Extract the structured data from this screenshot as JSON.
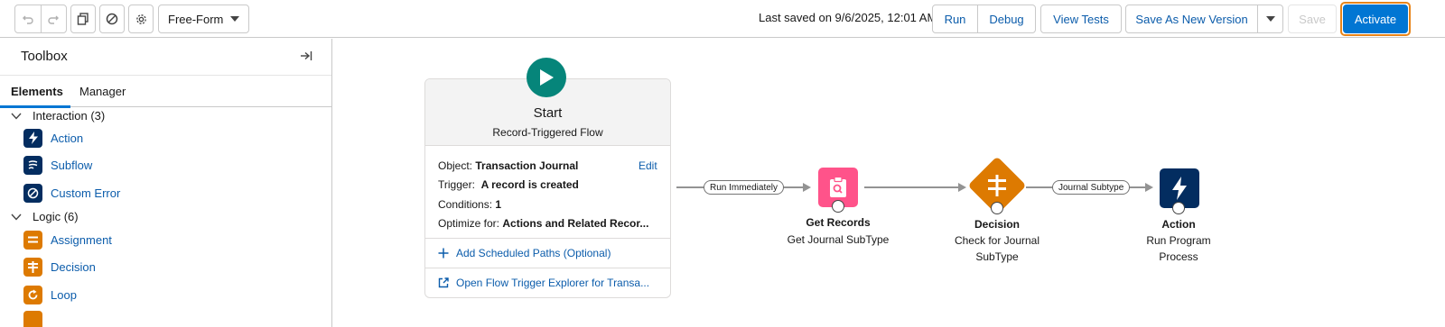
{
  "toolbar": {
    "undo_icon": "undo-icon",
    "redo_icon": "redo-icon",
    "copy_icon": "copy-icon",
    "block_icon": "block-icon",
    "gear_icon": "gear-icon",
    "layout_select": "Free-Form",
    "last_saved": "Last saved on 9/6/2025, 12:01 AM",
    "run_label": "Run",
    "debug_label": "Debug",
    "view_tests_label": "View Tests",
    "save_as_new_version_label": "Save As New Version",
    "save_label": "Save",
    "activate_label": "Activate",
    "colors": {
      "brand": "#0176d3",
      "focus_ring": "#e8851a",
      "disabled_text": "#c9c9c9"
    }
  },
  "sidebar": {
    "title": "Toolbox",
    "tabs": [
      {
        "label": "Elements",
        "active": true
      },
      {
        "label": "Manager",
        "active": false
      }
    ],
    "groups": [
      {
        "label": "Interaction (3)",
        "items": [
          {
            "label": "Action",
            "icon": "lightning-icon",
            "color": "#032d60"
          },
          {
            "label": "Subflow",
            "icon": "subflow-icon",
            "color": "#032d60"
          },
          {
            "label": "Custom Error",
            "icon": "block-icon",
            "color": "#032d60"
          }
        ]
      },
      {
        "label": "Logic (6)",
        "items": [
          {
            "label": "Assignment",
            "icon": "equals-icon",
            "color": "#dd7a01"
          },
          {
            "label": "Decision",
            "icon": "decision-icon",
            "color": "#dd7a01"
          },
          {
            "label": "Loop",
            "icon": "loop-icon",
            "color": "#dd7a01"
          }
        ]
      }
    ]
  },
  "start": {
    "title": "Start",
    "subtitle": "Record-Triggered Flow",
    "object_label": "Object:",
    "object_value": "Transaction Journal",
    "edit_label": "Edit",
    "trigger_label": "Trigger:",
    "trigger_value": "A record is created",
    "conditions_label": "Conditions:",
    "conditions_value": "1",
    "optimize_label": "Optimize for:",
    "optimize_value": "Actions and Related Recor...",
    "add_paths_label": "Add Scheduled Paths (Optional)",
    "explorer_label": "Open Flow Trigger Explorer for Transa..."
  },
  "connectors": {
    "first_label": "Run Immediately",
    "second_label": "Journal Subtype"
  },
  "nodes": [
    {
      "title": "Get Records",
      "subtitle": "Get Journal SubType",
      "icon": "get-records-icon",
      "color": "#ff538a"
    },
    {
      "title": "Decision",
      "subtitle_lines": [
        "Check for Journal",
        "SubType"
      ],
      "icon": "decision-icon",
      "color": "#dd7a01"
    },
    {
      "title": "Action",
      "subtitle_lines": [
        "Run Program",
        "Process"
      ],
      "icon": "lightning-icon",
      "color": "#032d60"
    }
  ]
}
